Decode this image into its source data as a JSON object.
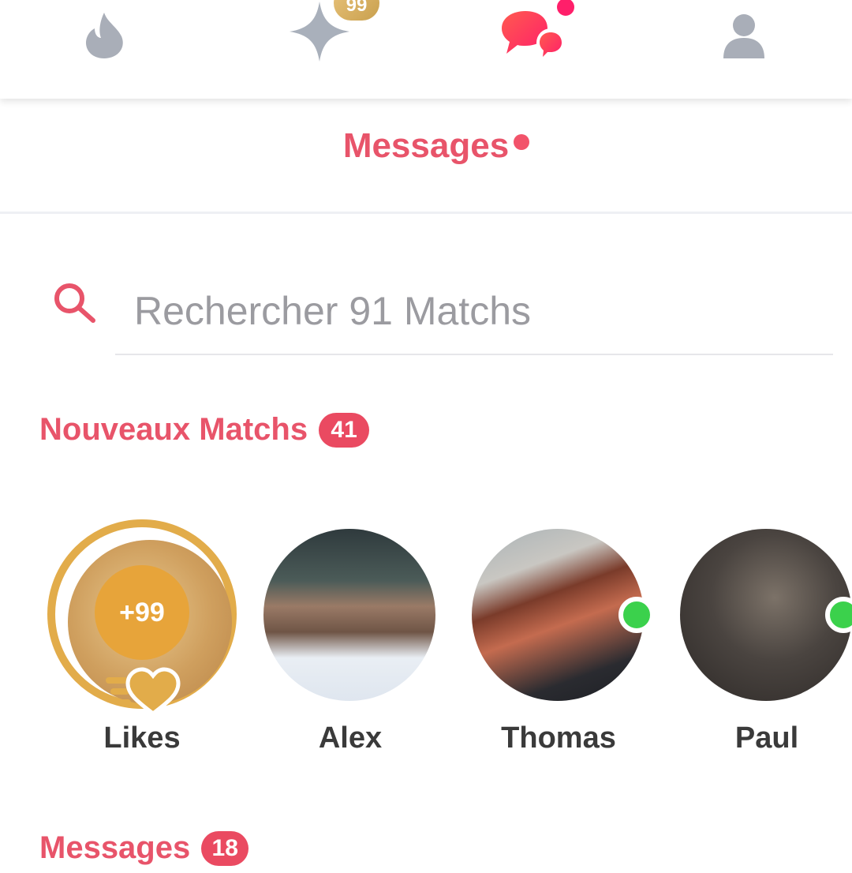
{
  "topnav": {
    "items": [
      {
        "name": "discover",
        "icon": "flame-icon",
        "active": false
      },
      {
        "name": "gold",
        "icon": "sparkle-icon",
        "badge": "99",
        "active": false
      },
      {
        "name": "messages",
        "icon": "chat-bubbles-icon",
        "notification_dot": true,
        "active": true
      },
      {
        "name": "profile",
        "icon": "person-icon",
        "active": false
      }
    ],
    "gold_badge": "99"
  },
  "header": {
    "title": "Messages"
  },
  "search": {
    "placeholder": "Rechercher 91 Matchs",
    "value": ""
  },
  "new_matches": {
    "label": "Nouveaux Matchs",
    "count": "41",
    "items": [
      {
        "name": "Likes",
        "count": "+99",
        "type": "likes"
      },
      {
        "name": "Alex",
        "online": false
      },
      {
        "name": "Thomas",
        "online": true
      },
      {
        "name": "Paul",
        "online": true
      }
    ]
  },
  "messages_section": {
    "label": "Messages",
    "count": "18"
  },
  "colors": {
    "accent": "#e8546a",
    "badge": "#ea4a61",
    "gold": "#e2ac4a",
    "online": "#3bd14c",
    "inactive_icon": "#a9aeb8"
  }
}
